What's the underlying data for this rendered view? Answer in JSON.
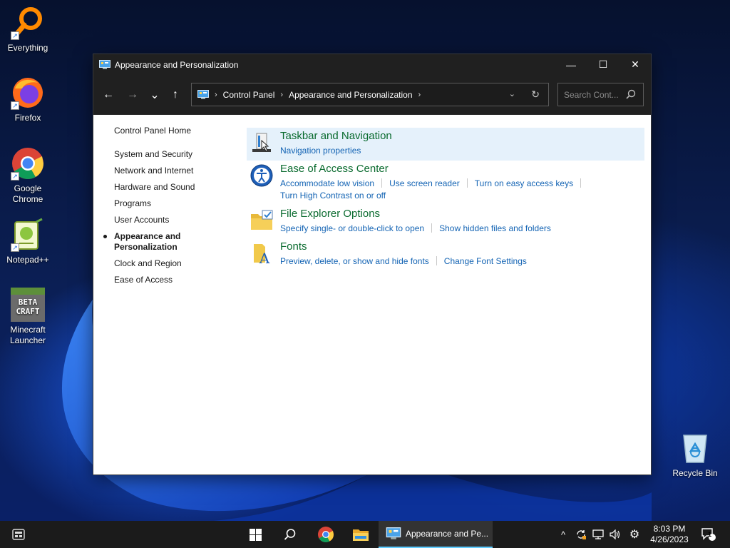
{
  "desktop": {
    "icons": [
      {
        "label": "Everything"
      },
      {
        "label": "Firefox"
      },
      {
        "label": "Google Chrome"
      },
      {
        "label": "Notepad++"
      },
      {
        "label": "Minecraft Launcher"
      },
      {
        "label": "Recycle Bin"
      }
    ],
    "minecraft_logo_text": "BETA CRAFT"
  },
  "window": {
    "title": "Appearance and Personalization",
    "controls": {
      "minimize": "—",
      "maximize": "☐",
      "close": "✕"
    }
  },
  "nav": {
    "back": "←",
    "forward": "→",
    "recent": "⌄",
    "up": "↑",
    "breadcrumb": [
      "Control Panel",
      "Appearance and Personalization"
    ],
    "search_placeholder": "Search Cont..."
  },
  "sidebar": {
    "home": "Control Panel Home",
    "items": [
      {
        "label": "System and Security"
      },
      {
        "label": "Network and Internet"
      },
      {
        "label": "Hardware and Sound"
      },
      {
        "label": "Programs"
      },
      {
        "label": "User Accounts"
      },
      {
        "label": "Appearance and Personalization",
        "current": true
      },
      {
        "label": "Clock and Region"
      },
      {
        "label": "Ease of Access"
      }
    ]
  },
  "categories": [
    {
      "title": "Taskbar and Navigation",
      "links": [
        "Navigation properties"
      ]
    },
    {
      "title": "Ease of Access Center",
      "links": [
        "Accommodate low vision",
        "Use screen reader",
        "Turn on easy access keys",
        "Turn High Contrast on or off"
      ]
    },
    {
      "title": "File Explorer Options",
      "links": [
        "Specify single- or double-click to open",
        "Show hidden files and folders"
      ]
    },
    {
      "title": "Fonts",
      "links": [
        "Preview, delete, or show and hide fonts",
        "Change Font Settings"
      ]
    }
  ],
  "taskbar": {
    "active_window_label": "Appearance and Pe...",
    "clock_time": "8:03 PM",
    "clock_date": "4/26/2023",
    "notification_count": "1"
  },
  "colors": {
    "link": "#1464b4",
    "category_title": "#0a6b2f",
    "highlight": "#e5f1fb",
    "titlebar": "#202020",
    "taskbar": "#1b1b1b"
  }
}
